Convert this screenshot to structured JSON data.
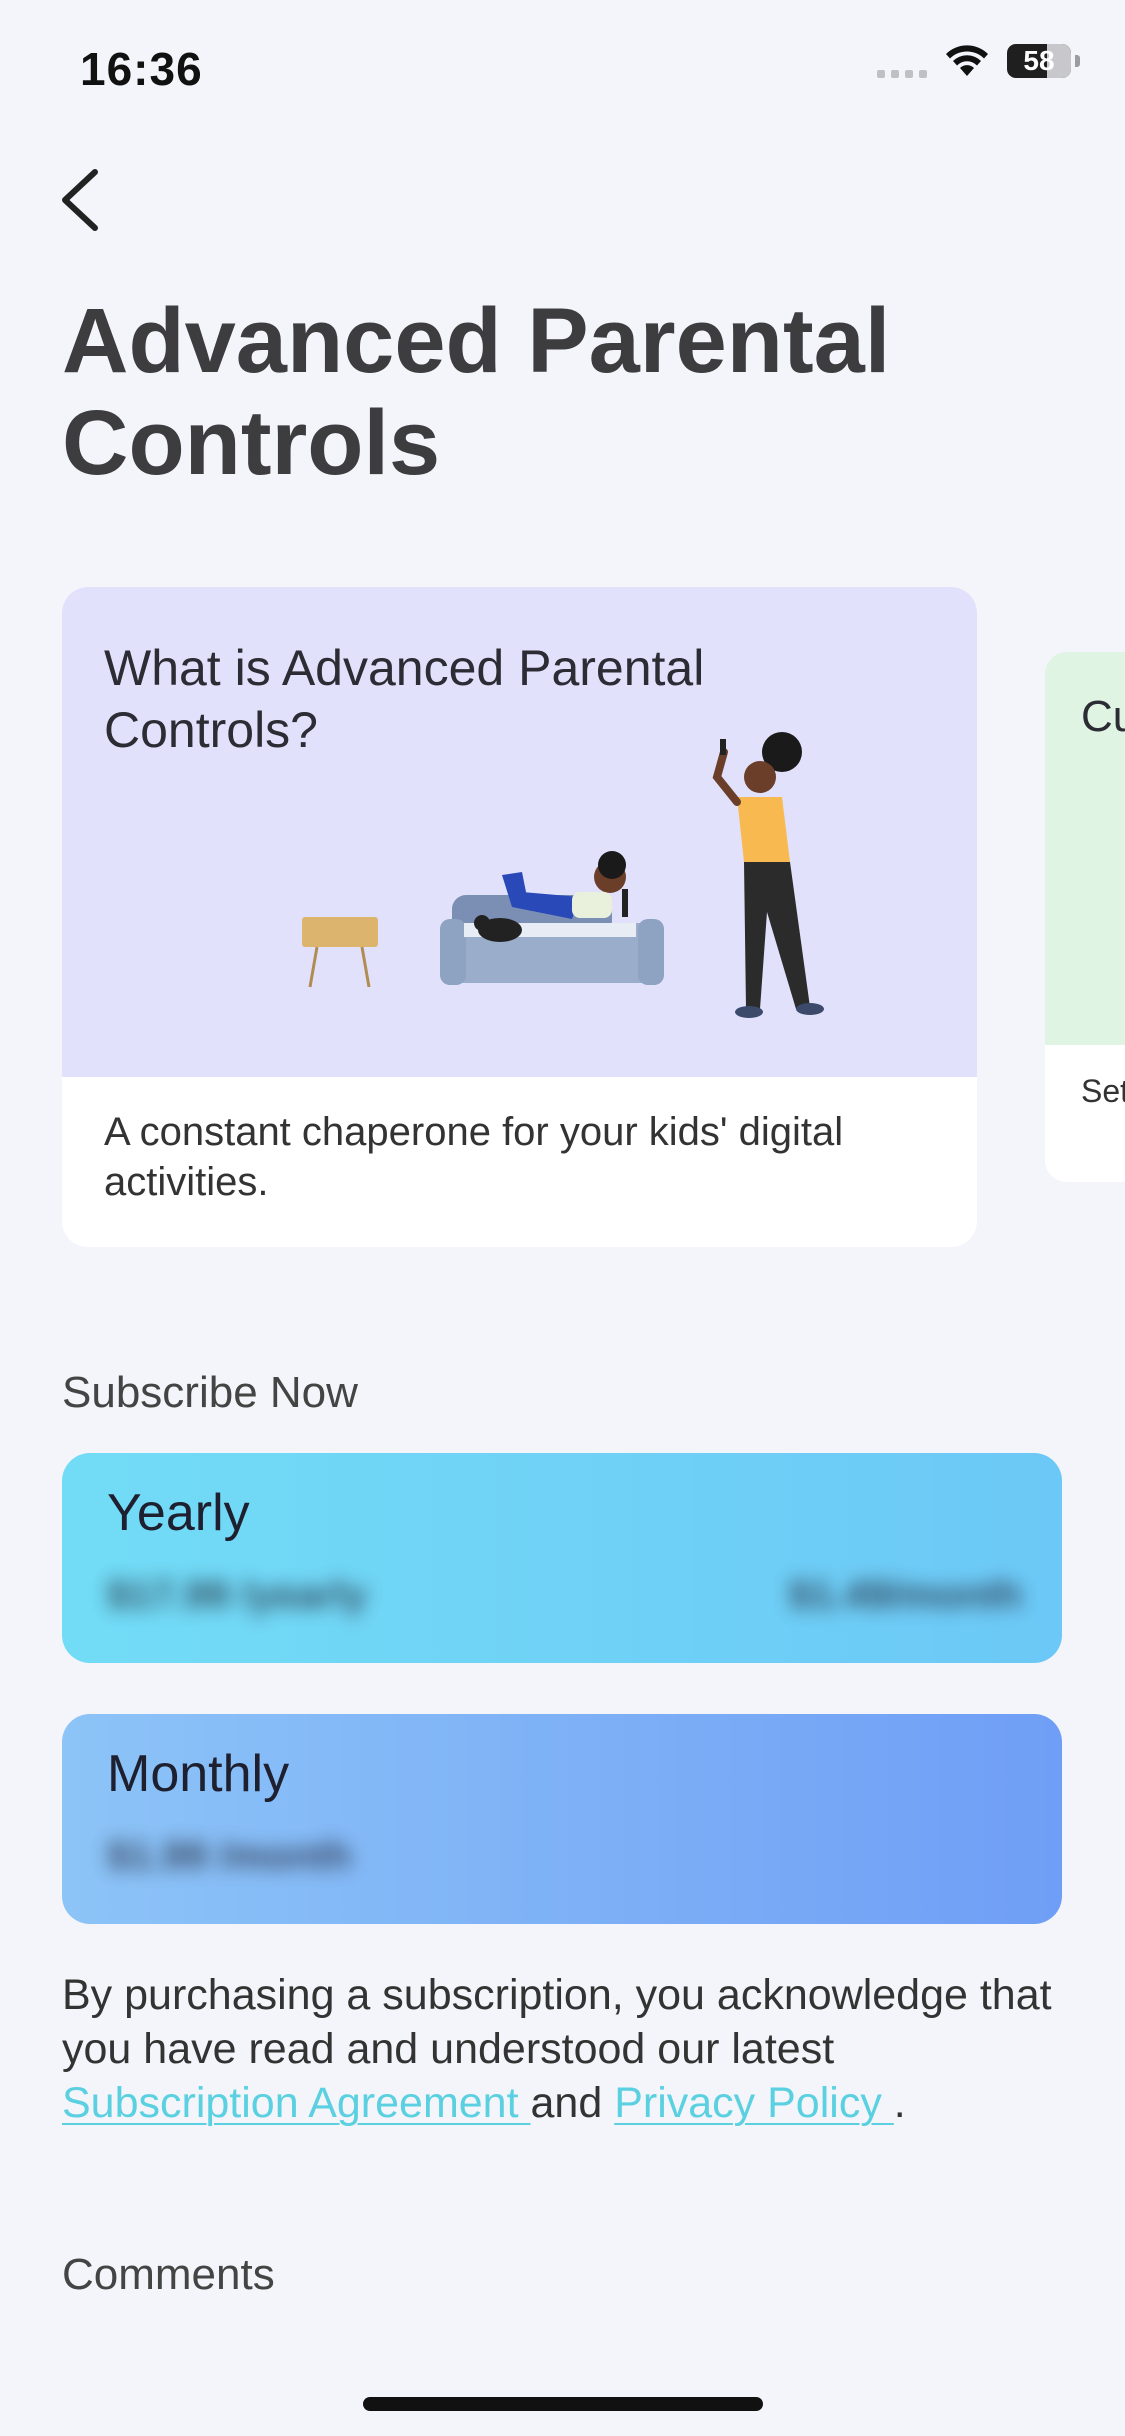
{
  "status_bar": {
    "time": "16:36",
    "battery": "58"
  },
  "page": {
    "title": "Advanced Parental Controls"
  },
  "carousel": {
    "cards": [
      {
        "title": "What is Advanced Parental Controls?",
        "description": "A constant chaperone for your kids' digital activities."
      },
      {
        "title": "Cu",
        "description": "Set hou"
      }
    ]
  },
  "subscribe": {
    "heading": "Subscribe Now",
    "plans": [
      {
        "name": "Yearly",
        "price": "$17.99 /yearly",
        "per_month": "$1.49/month"
      },
      {
        "name": "Monthly",
        "price": "$1.99 /month"
      }
    ]
  },
  "legal": {
    "text_before": "By purchasing a subscription, you acknowledge that you have read and understood our latest ",
    "subscription_link": "Subscription Agreement ",
    "text_middle": "and ",
    "privacy_link": "Privacy Policy ",
    "text_after": "."
  },
  "comments": {
    "heading": "Comments"
  },
  "colors": {
    "background": "#f4f5fa",
    "card_purple": "#e1e1fc",
    "card_green": "#dff4e3",
    "yearly_gradient": [
      "#72dcf6",
      "#6cc8f6"
    ],
    "monthly_gradient": [
      "#8cc4f7",
      "#6f9ef6"
    ],
    "link": "#5ad0e1"
  }
}
